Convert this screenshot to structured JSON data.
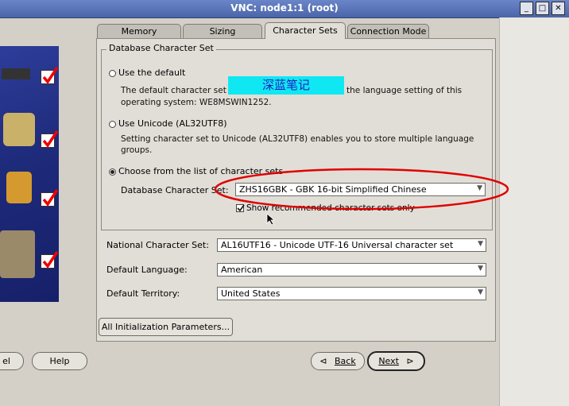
{
  "window": {
    "title": "VNC: node1:1 (root)",
    "minimize_glyph": "_",
    "maximize_glyph": "□",
    "close_glyph": "✕"
  },
  "tabs": [
    {
      "label": "Memory",
      "active": false
    },
    {
      "label": "Sizing",
      "active": false
    },
    {
      "label": "Character Sets",
      "active": true
    },
    {
      "label": "Connection Mode",
      "active": false
    }
  ],
  "db_charset_group": {
    "title": "Database Character Set",
    "option_default": {
      "label": "Use the default",
      "desc_line1": "The default character set",
      "desc_line1b": "the language setting of this",
      "desc_line2": "operating system: WE8MSWIN1252."
    },
    "option_unicode": {
      "label": "Use Unicode (AL32UTF8)",
      "desc_line1": "Setting character set to Unicode (AL32UTF8) enables you to store multiple language",
      "desc_line2": "groups."
    },
    "option_list": {
      "label": "Choose from the list of character sets",
      "selected": true
    },
    "db_charset_label": "Database Character Set:",
    "db_charset_value": "ZHS16GBK - GBK 16-bit Simplified Chinese",
    "show_recommended_label": "Show recommended character sets only",
    "show_recommended_checked": true
  },
  "national_charset": {
    "label": "National Character Set:",
    "value": "AL16UTF16 - Unicode UTF-16 Universal character set"
  },
  "default_language": {
    "label": "Default Language:",
    "value": "American"
  },
  "default_territory": {
    "label": "Default Territory:",
    "value": "United States"
  },
  "buttons": {
    "all_init_params": "All Initialization Parameters...",
    "cancel_partial": "el",
    "help": "Help",
    "back": "Back",
    "back_icon": "⊲",
    "next": "Next",
    "next_icon": "⊳"
  },
  "watermark_text": "深蓝笔记",
  "colors": {
    "titlebar": "#5470b8",
    "panel": "#e1ded7",
    "highlight_circle": "#e00000",
    "watermark_bg": "#0fe8f2"
  }
}
